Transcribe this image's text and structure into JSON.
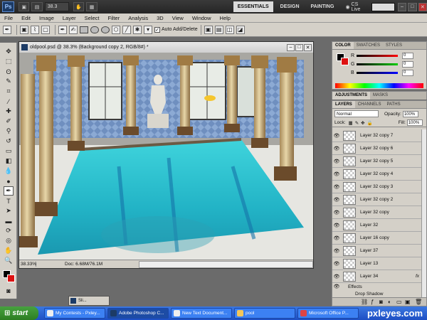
{
  "titlebar": {
    "app_logo": "Ps",
    "zoom": "38.3",
    "workspaces": [
      "ESSENTIALS",
      "DESIGN",
      "PAINTING"
    ],
    "live_label": "CS Live",
    "window_controls": [
      "–",
      "□",
      "✕"
    ]
  },
  "menu": [
    "File",
    "Edit",
    "Image",
    "Layer",
    "Select",
    "Filter",
    "Analysis",
    "3D",
    "View",
    "Window",
    "Help"
  ],
  "options": {
    "auto_add_delete": "Auto Add/Delete"
  },
  "document": {
    "title": "oldpool.psd @ 38.3% (Background copy 2, RGB/8#) *",
    "zoom": "38.33%",
    "doc_info": "Doc: 6.68M/76.1M"
  },
  "color_panel": {
    "tabs": [
      "COLOR",
      "SWATCHES",
      "STYLES"
    ],
    "sliders": [
      {
        "letter": "R",
        "value": "0"
      },
      {
        "letter": "G",
        "value": "0"
      },
      {
        "letter": "B",
        "value": "0"
      }
    ]
  },
  "adjustments_tabs": [
    "ADJUSTMENTS",
    "MASKS"
  ],
  "layers_panel": {
    "tabs": [
      "LAYERS",
      "CHANNELS",
      "PATHS"
    ],
    "blend_mode": "Normal",
    "opacity_label": "Opacity:",
    "opacity": "100%",
    "lock_label": "Lock:",
    "fill_label": "Fill:",
    "fill": "100%",
    "layers": [
      {
        "name": "Layer 32 copy 7",
        "fx": ""
      },
      {
        "name": "Layer 32 copy 6",
        "fx": ""
      },
      {
        "name": "Layer 32 copy 5",
        "fx": ""
      },
      {
        "name": "Layer 32 copy 4",
        "fx": ""
      },
      {
        "name": "Layer 32 copy 3",
        "fx": ""
      },
      {
        "name": "Layer 32 copy 2",
        "fx": ""
      },
      {
        "name": "Layer 32 copy",
        "fx": ""
      },
      {
        "name": "Layer 32",
        "fx": ""
      },
      {
        "name": "Layer 16 copy",
        "fx": ""
      },
      {
        "name": "Layer 37",
        "fx": ""
      },
      {
        "name": "Layer 13",
        "fx": ""
      },
      {
        "name": "Layer 34",
        "fx": "fx"
      }
    ],
    "effects_label": "Effects",
    "drop_shadow_label": "Drop Shadow"
  },
  "mini_doc": "Sli...",
  "taskbar": {
    "start": "start",
    "tasks": [
      {
        "label": "My Contests - Pxley..."
      },
      {
        "label": "Adobe Photoshop C..."
      },
      {
        "label": "New Text Document..."
      },
      {
        "label": "pool"
      },
      {
        "label": "Microsoft Office P..."
      }
    ],
    "brand": "pxleyes.com"
  }
}
